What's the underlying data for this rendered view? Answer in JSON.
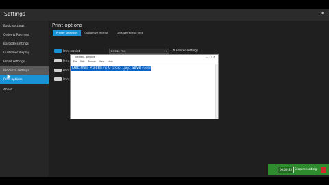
{
  "window": {
    "title": "Settings"
  },
  "sidebar": {
    "items": [
      {
        "label": "Basic settings"
      },
      {
        "label": "Order & Payment"
      },
      {
        "label": "Barcode settings"
      },
      {
        "label": "Customer display"
      },
      {
        "label": "Email settings"
      },
      {
        "label": "Products settings"
      },
      {
        "label": "Print options"
      },
      {
        "label": "About"
      }
    ]
  },
  "content": {
    "title": "Print options",
    "tabs": [
      {
        "label": "Printer selection"
      },
      {
        "label": "Customize receipt"
      },
      {
        "label": "Localize receipt text"
      }
    ],
    "rows": [
      {
        "label": "Print receipt"
      },
      {
        "label": "Print kitchen sale"
      },
      {
        "label": "Print"
      },
      {
        "label": "Print"
      }
    ],
    "printer_select": {
      "value": "POS80 PRO"
    },
    "printer_settings_label": "Printer settings"
  },
  "notepad": {
    "title": "Untitled - Notepad",
    "menu": [
      "File",
      "Edit",
      "Format",
      "View",
      "Help"
    ],
    "selected_text": "Decimail Places ကို 0 ထားပါ ပြီးရင် Save လုပ်ပါ"
  },
  "recording": {
    "timer": "00:00:33",
    "stop_label": "Stop recording"
  }
}
